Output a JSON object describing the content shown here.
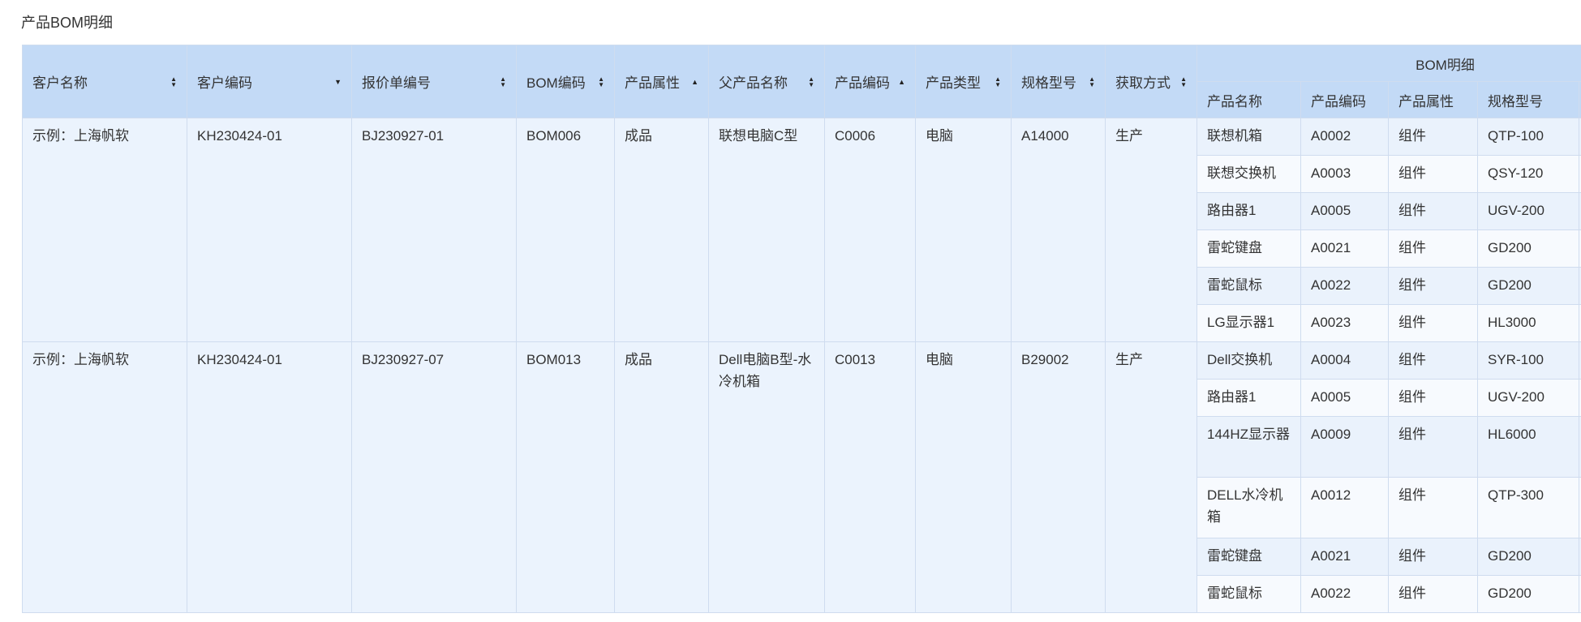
{
  "page_title": "产品BOM明细",
  "columns": [
    {
      "label": "客户名称",
      "sort": "both"
    },
    {
      "label": "客户编码",
      "sort": "desc"
    },
    {
      "label": "报价单编号",
      "sort": "both"
    },
    {
      "label": "BOM编码",
      "sort": "both"
    },
    {
      "label": "产品属性",
      "sort": "asc"
    },
    {
      "label": "父产品名称",
      "sort": "both"
    },
    {
      "label": "产品编码",
      "sort": "asc"
    },
    {
      "label": "产品类型",
      "sort": "both"
    },
    {
      "label": "规格型号",
      "sort": "both"
    },
    {
      "label": "获取方式",
      "sort": "both"
    }
  ],
  "group_header": "BOM明细",
  "sub_columns": [
    "产品名称",
    "产品编码",
    "产品属性",
    "规格型号"
  ],
  "rows": [
    {
      "customer": "示例：上海帆软",
      "customer_code": "KH230424-01",
      "quote_no": "BJ230927-01",
      "bom_code": "BOM006",
      "attr": "成品",
      "parent_name": "联想电脑C型",
      "product_code": "C0006",
      "type": "电脑",
      "spec": "A14000",
      "method": "生产",
      "details": [
        [
          "联想机箱",
          "A0002",
          "组件",
          "QTP-100"
        ],
        [
          "联想交换机",
          "A0003",
          "组件",
          "QSY-120"
        ],
        [
          "路由器1",
          "A0005",
          "组件",
          "UGV-200"
        ],
        [
          "雷蛇键盘",
          "A0021",
          "组件",
          "GD200"
        ],
        [
          "雷蛇鼠标",
          "A0022",
          "组件",
          "GD200"
        ],
        [
          "LG显示器1",
          "A0023",
          "组件",
          "HL3000"
        ]
      ]
    },
    {
      "customer": "示例：上海帆软",
      "customer_code": "KH230424-01",
      "quote_no": "BJ230927-07",
      "bom_code": "BOM013",
      "attr": "成品",
      "parent_name": "Dell电脑B型-水冷机箱",
      "product_code": "C0013",
      "type": "电脑",
      "spec": "B29002",
      "method": "生产",
      "details": [
        [
          "Dell交换机",
          "A0004",
          "组件",
          "SYR-100"
        ],
        [
          "路由器1",
          "A0005",
          "组件",
          "UGV-200"
        ],
        [
          "144HZ显示器",
          "A0009",
          "组件",
          "HL6000"
        ],
        [
          "DELL水冷机箱",
          "A0012",
          "组件",
          "QTP-300"
        ],
        [
          "雷蛇键盘",
          "A0021",
          "组件",
          "GD200"
        ],
        [
          "雷蛇鼠标",
          "A0022",
          "组件",
          "GD200"
        ]
      ]
    }
  ]
}
